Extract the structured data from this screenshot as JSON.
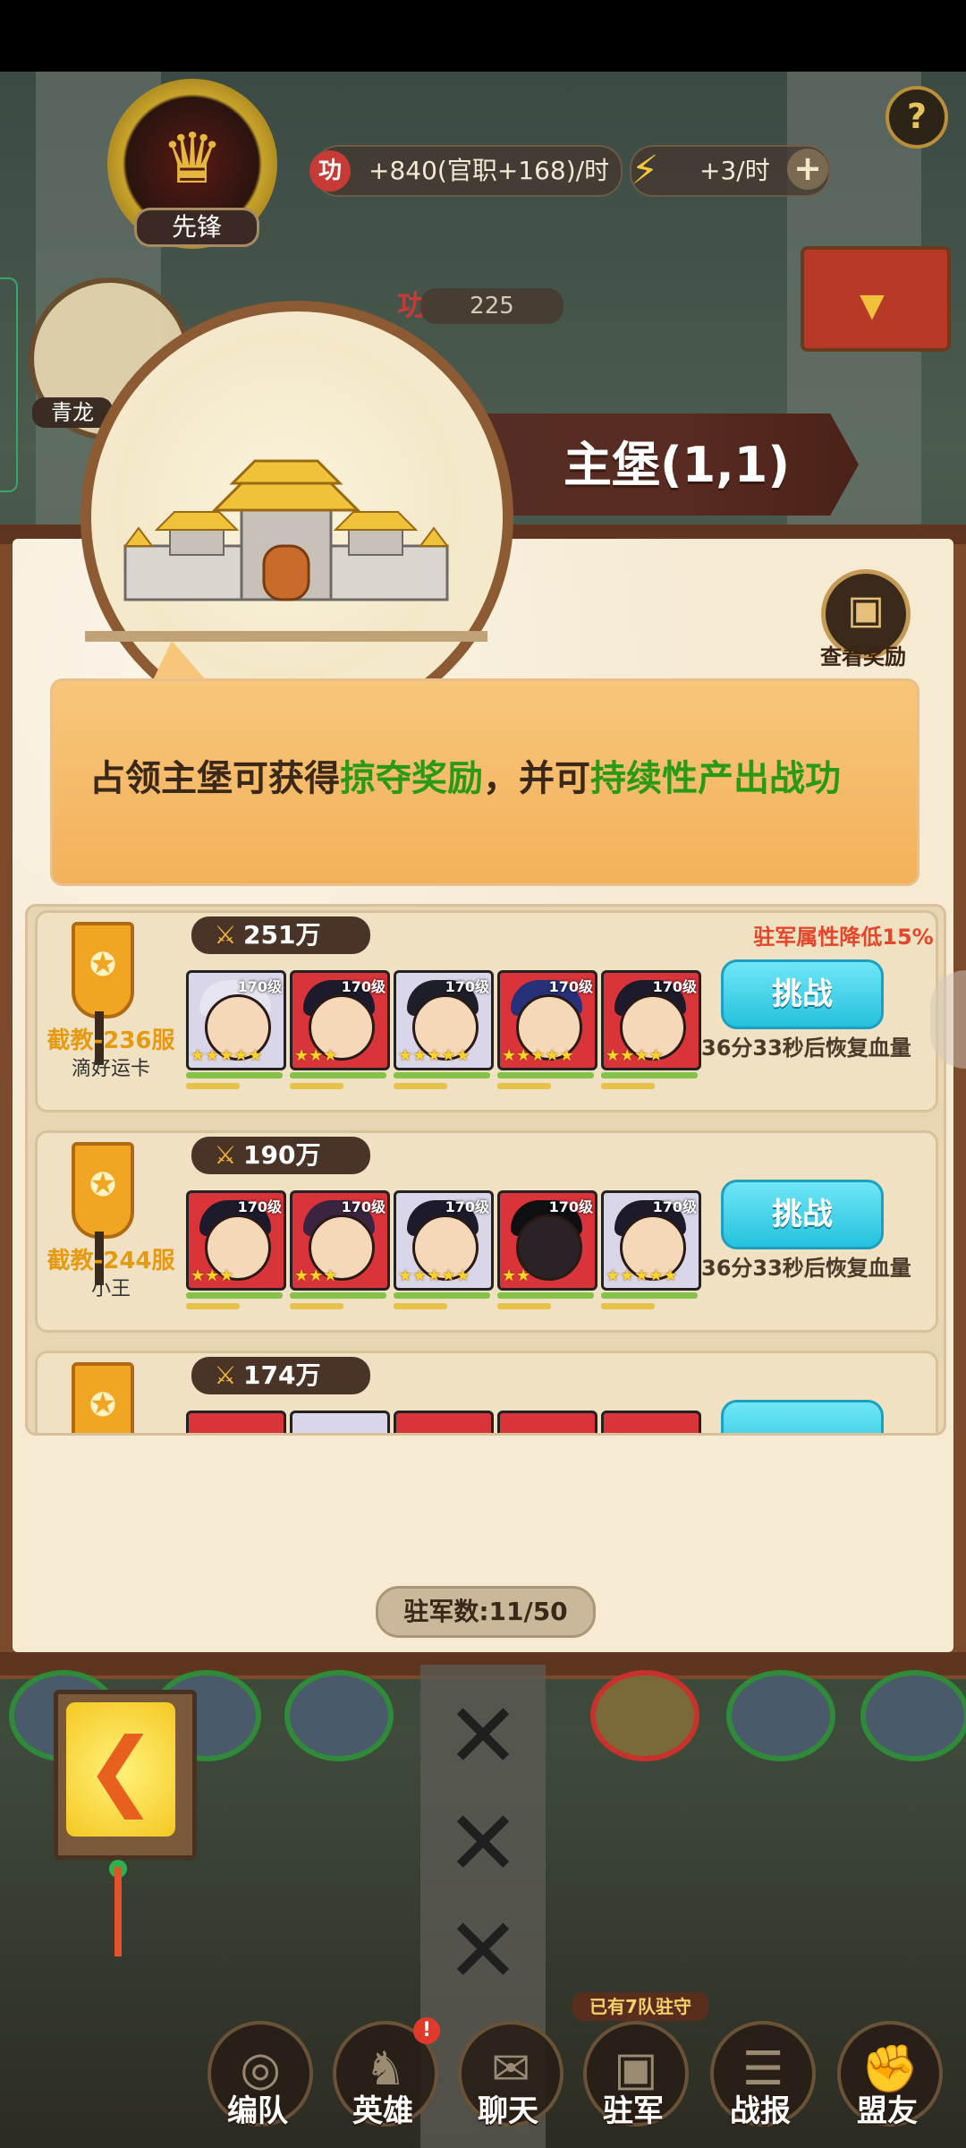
{
  "header": {
    "rank_label": "先锋",
    "resource_income": "+840(官职+168)/时",
    "energy_income": "+3/时",
    "help": "?"
  },
  "map": {
    "count": "225",
    "side_label": "青龙"
  },
  "castle": {
    "title": "主堡(1,1)"
  },
  "reward": {
    "label": "查看奖励"
  },
  "info": {
    "part1": "占领主堡可获得",
    "highlight1": "掠夺奖励",
    "part2": "，并可",
    "highlight2": "持续性产出战功"
  },
  "garrisons": [
    {
      "server": "截教-236服",
      "player": "滴好运卡",
      "power": "251万",
      "reduce": "驻军属性降低15%",
      "button": "挑战",
      "restore": "36分33秒后恢复血量",
      "heroes": [
        {
          "level": "170级",
          "stars": "★★★★★"
        },
        {
          "level": "170级",
          "stars": "★★★"
        },
        {
          "level": "170级",
          "stars": "★★★★★"
        },
        {
          "level": "170级",
          "stars": "★★★★★"
        },
        {
          "level": "170级",
          "stars": "★★★★"
        }
      ]
    },
    {
      "server": "截教-244服",
      "player": "小王",
      "power": "190万",
      "reduce": "",
      "button": "挑战",
      "restore": "36分33秒后恢复血量",
      "heroes": [
        {
          "level": "170级",
          "stars": "★★★"
        },
        {
          "level": "170级",
          "stars": "★★★"
        },
        {
          "level": "170级",
          "stars": "★★★★★"
        },
        {
          "level": "170级",
          "stars": "★★"
        },
        {
          "level": "170级",
          "stars": "★★★★★"
        }
      ]
    },
    {
      "power": "174万"
    }
  ],
  "garrison_count": "驻军数:11/50",
  "bottom": {
    "hint": "已有7队驻守",
    "badge": "!",
    "nav": [
      "编队",
      "英雄",
      "聊天",
      "驻军",
      "战报",
      "盟友"
    ]
  },
  "colors": {
    "accent_green": "#2a9a16",
    "challenge_cyan": "#25c2dd",
    "warning_red": "#e3462a",
    "server_orange": "#e59a12"
  }
}
